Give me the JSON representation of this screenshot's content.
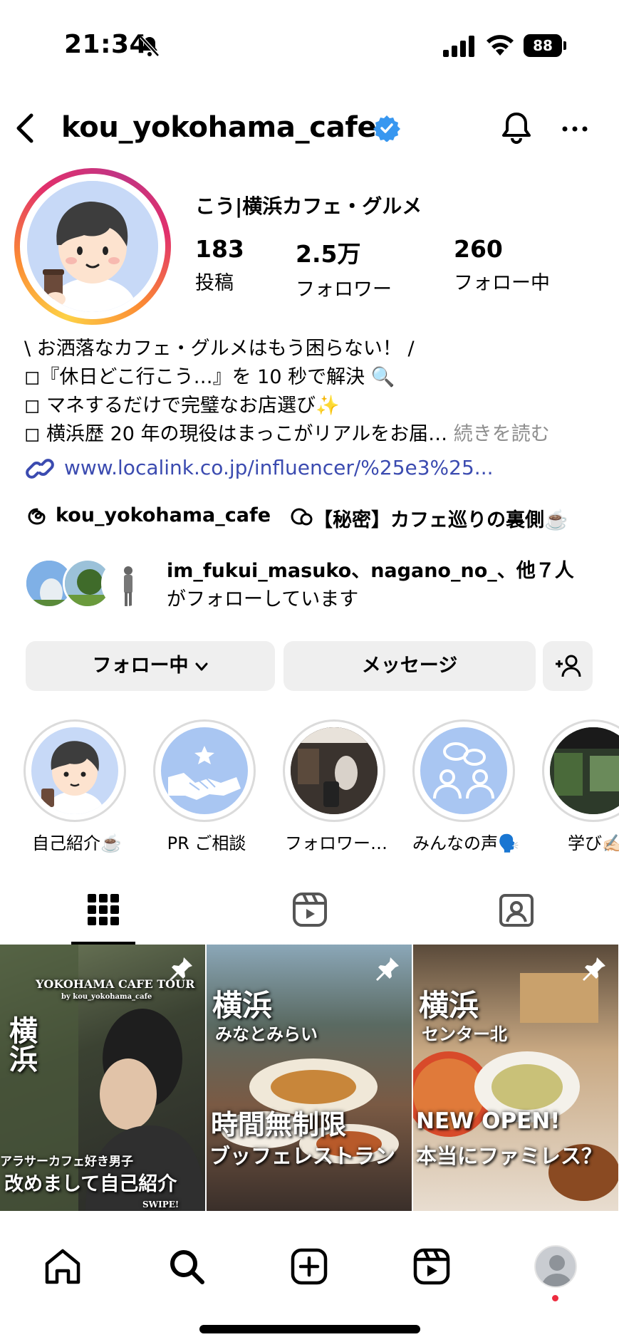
{
  "status_bar": {
    "time": "21:34",
    "battery": "88"
  },
  "header": {
    "username": "kou_yokohama_cafe"
  },
  "profile": {
    "display_name": "こう|横浜カフェ・グルメ",
    "stats": [
      {
        "value": "183",
        "label": "投稿"
      },
      {
        "value": "2.5万",
        "label": "フォロワー"
      },
      {
        "value": "260",
        "label": "フォロー中"
      }
    ],
    "bio": [
      "\\ お洒落なカフェ・グルメはもう困らない！ /",
      "◻︎『休日どこ行こう…』を 10 秒で解決 🔍",
      "◻︎ マネするだけで完璧なお店選び✨",
      "◻︎ 横浜歴 20 年の現役はまっこがリアルをお届…"
    ],
    "bio_more": "続きを読む",
    "link": "www.localink.co.jp/influencer/%25e3%25...",
    "threads_name": "kou_yokohama_cafe",
    "threads_post": "【秘密】カフェ巡りの裏側☕️",
    "followed_by_line1": "im_fukui_masuko、nagano_no_、他７人",
    "followed_by_line2": "がフォローしています"
  },
  "actions": {
    "following": "フォロー中",
    "message": "メッセージ"
  },
  "highlights": [
    {
      "label": "自己紹介☕️"
    },
    {
      "label": "PR ご相談"
    },
    {
      "label": "フォロワー…"
    },
    {
      "label": "みんなの声🗣️"
    },
    {
      "label": "学び✍🏻"
    }
  ],
  "posts": [
    {
      "title": "YOKOHAMA CAFE TOUR",
      "subtitle": "by kou_yokohama_cafe",
      "side": "横浜",
      "line1": "アラサーカフェ好き男子",
      "line2": "改めまして自己紹介",
      "footer": "SWIPE!"
    },
    {
      "city": "横浜",
      "area": "みなとみらい",
      "line1": "時間無制限",
      "line2": "ブッフェレストラン"
    },
    {
      "city": "横浜",
      "area": "センター北",
      "line1": "NEW OPEN!",
      "line2": "本当にファミレス？"
    }
  ],
  "colors": {
    "accent": "#3897f0",
    "link": "#3b4bb0",
    "button_bg": "#efefef"
  }
}
